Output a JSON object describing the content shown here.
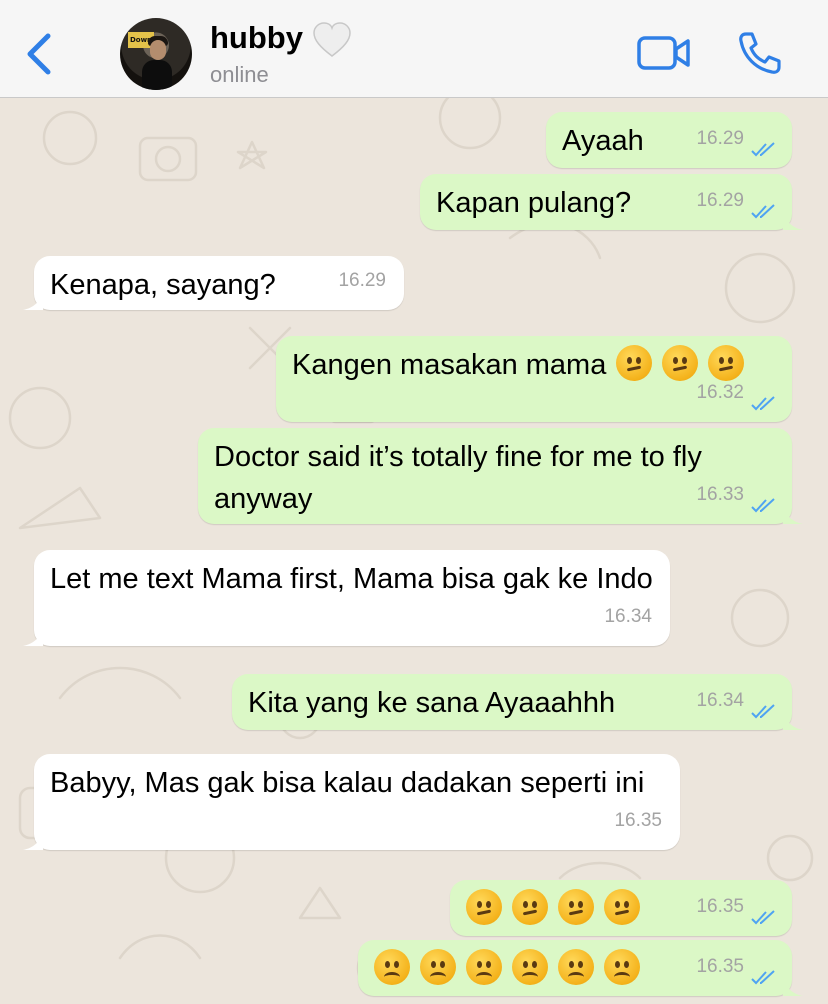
{
  "header": {
    "contact_name": "hubby",
    "status": "online",
    "heart": "🤍"
  },
  "messages": [
    {
      "dir": "out",
      "text": "Ayaah",
      "time": "16.29",
      "ticks": "read"
    },
    {
      "dir": "out",
      "text": "Kapan pulang?",
      "time": "16.29",
      "ticks": "read"
    },
    {
      "dir": "in",
      "text": "Kenapa, sayang?",
      "time": "16.29"
    },
    {
      "dir": "out",
      "text": "Kangen masakan mama",
      "emoji": [
        "confused",
        "confused",
        "confused"
      ],
      "time": "16.32",
      "ticks": "read"
    },
    {
      "dir": "out",
      "text": "Doctor said it’s totally fine for me to fly anyway",
      "time": "16.33",
      "ticks": "read"
    },
    {
      "dir": "in",
      "text": "Let me text Mama first, Mama bisa gak ke Indo",
      "time": "16.34"
    },
    {
      "dir": "out",
      "text": "Kita yang ke sana Ayaaahhh",
      "time": "16.34",
      "ticks": "read"
    },
    {
      "dir": "in",
      "text": "Babyy, Mas gak bisa kalau dadakan seperti ini",
      "time": "16.35"
    },
    {
      "dir": "out",
      "text": "",
      "emoji": [
        "confused",
        "confused",
        "confused",
        "confused"
      ],
      "time": "16.35",
      "ticks": "read"
    },
    {
      "dir": "out",
      "text": "",
      "emoji": [
        "frowning",
        "frowning",
        "frowning",
        "frowning",
        "frowning",
        "frowning"
      ],
      "time": "16.35",
      "ticks": "read"
    }
  ],
  "colors": {
    "accent": "#2f7fe6",
    "outgoing_bubble": "#dbf8c6",
    "incoming_bubble": "#ffffff",
    "read_ticks": "#4fa3f2"
  }
}
